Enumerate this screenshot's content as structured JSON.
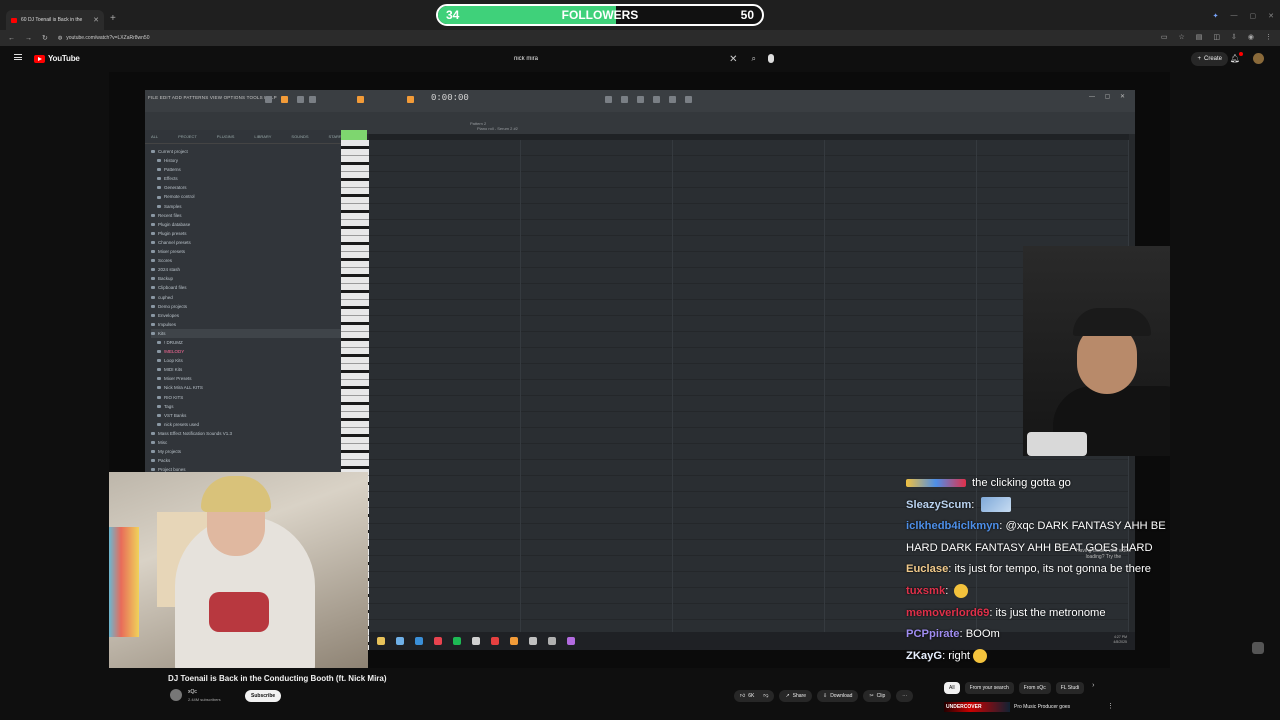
{
  "browser": {
    "tab_title": "60 DJ Toenail is Back in the",
    "url": "youtube.com/watch?v=LXZaRr8wn50"
  },
  "goal": {
    "min": "34",
    "label": "FOLLOWERS",
    "max": "50",
    "progress": 0.55,
    "fill_color": "#3fd17a"
  },
  "youtube": {
    "logo_text": "YouTube",
    "search_value": "nick mira",
    "create_label": "Create",
    "brand_color": "#ff0000"
  },
  "fl": {
    "menu": "FILE  EDIT  ADD  PATTERNS  VIEW  OPTIONS  TOOLS  HELP",
    "time": "0:00:00",
    "pattern": "Pattern 2",
    "pianoroll_label": "Piano roll - Serum 2 #2",
    "browser_tabs": [
      "ALL",
      "PROJECT",
      "PLUGINS",
      "LIBRARY",
      "SOUNDS",
      "STARRED"
    ],
    "browser_items": [
      {
        "label": "Current project",
        "level": 0
      },
      {
        "label": "History",
        "level": 1
      },
      {
        "label": "Patterns",
        "level": 1
      },
      {
        "label": "Effects",
        "level": 1
      },
      {
        "label": "Generators",
        "level": 1
      },
      {
        "label": "Remote control",
        "level": 1
      },
      {
        "label": "Samples",
        "level": 1
      },
      {
        "label": "Recent files",
        "level": 0
      },
      {
        "label": "Plugin database",
        "level": 0
      },
      {
        "label": "Plugin presets",
        "level": 0
      },
      {
        "label": "Channel presets",
        "level": 0
      },
      {
        "label": "Mixer presets",
        "level": 0
      },
      {
        "label": "Scores",
        "level": 0
      },
      {
        "label": "2024 stash",
        "level": 0
      },
      {
        "label": "Backup",
        "level": 0
      },
      {
        "label": "Clipboard files",
        "level": 0
      },
      {
        "label": "cuphed",
        "level": 0
      },
      {
        "label": "Demo projects",
        "level": 0
      },
      {
        "label": "Envelopes",
        "level": 0
      },
      {
        "label": "Impulses",
        "level": 0
      },
      {
        "label": "Kits",
        "level": 0
      },
      {
        "label": "! DRUMZ",
        "level": 1
      },
      {
        "label": "!MELODY",
        "level": 1
      },
      {
        "label": "Loop Kits",
        "level": 1
      },
      {
        "label": "MIDI Kits",
        "level": 1
      },
      {
        "label": "Mixer Presets",
        "level": 1
      },
      {
        "label": "Nick Mira ALL KITS",
        "level": 1
      },
      {
        "label": "RIO KITS",
        "level": 1
      },
      {
        "label": "Tags",
        "level": 1
      },
      {
        "label": "VST Banks",
        "level": 1
      },
      {
        "label": "nick presets used",
        "level": 1
      },
      {
        "label": "Mass Effect Notification Sounds V1.3",
        "level": 0
      },
      {
        "label": "Misc",
        "level": 0
      },
      {
        "label": "My projects",
        "level": 0
      },
      {
        "label": "Packs",
        "level": 0
      },
      {
        "label": "Project bones",
        "level": 0
      }
    ],
    "clock": "4:27 PM",
    "date": "4/8/2025",
    "taskbar_colors": [
      "#e8c25a",
      "#6fb0e8",
      "#3a8fd8",
      "#e8434f",
      "#1db954",
      "#d0d0d0",
      "#e64040",
      "#f29b38",
      "#c0c0c0",
      "#b0b0b0",
      "#b36be0"
    ]
  },
  "chat": [
    {
      "user": "",
      "text": "the clicking gotta go",
      "color": "#f0c040"
    },
    {
      "user": "SleazyScum",
      "text": "",
      "color": "#b9d2ef",
      "emote": "img"
    },
    {
      "user": "iclkhedb4iclkmyn",
      "text": "@xqc DARK FANTASY AHH BE",
      "color": "#4d8fe8"
    },
    {
      "user": "",
      "text": "HARD DARK FANTASY AHH BEAT GOES HARD",
      "color": "#ffffff"
    },
    {
      "user": "Euclase",
      "text": "its just for tempo, its not gonna be there",
      "color": "#f0c98a"
    },
    {
      "user": "tuxsmk",
      "text": "",
      "color": "#e0304a",
      "emote": "yellow"
    },
    {
      "user": "memoverlord69",
      "text": "its just the metronome",
      "color": "#e0304a"
    },
    {
      "user": "PCPpirate",
      "text": "BOOm",
      "color": "#9f8cf0"
    },
    {
      "user": "ZKayG",
      "text": "right",
      "color": "#e8f0ff",
      "emote": "yellow"
    }
  ],
  "video_error": [
    "Having issues with video",
    "loading? Try the"
  ],
  "video": {
    "title": "DJ Toenail is Back in the Conducting Booth (ft. Nick Mira)",
    "channel": "xQc",
    "subscribers": "2.44M subscribers",
    "subscribe_label": "Subscribe",
    "likes": "6K",
    "share_label": "Share",
    "download_label": "Download",
    "clip_label": "Clip"
  },
  "chips": [
    "All",
    "From your search",
    "From xQc",
    "FL Studi"
  ],
  "recommendation": {
    "thumb_text": "UNDERCOVER",
    "title": "Pro Music Producer goes"
  }
}
